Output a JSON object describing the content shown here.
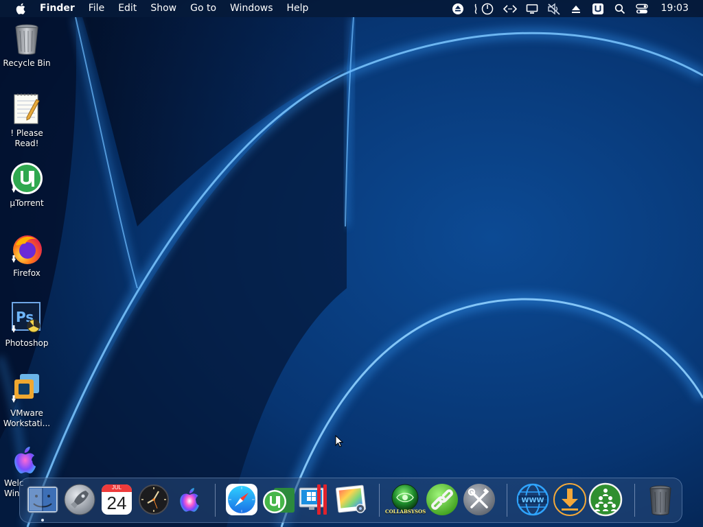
{
  "menubar": {
    "apple_icon": "apple-logo-icon",
    "items": [
      "Finder",
      "File",
      "Edit",
      "Show",
      "Go to",
      "Windows",
      "Help"
    ],
    "status_icons": [
      "eject-icon",
      "power-timer-icon",
      "code-icon",
      "display-icon",
      "mute-icon",
      "upload-arrow-icon",
      "u-badge-icon",
      "search-icon",
      "control-center-icon"
    ],
    "clock": "19:03"
  },
  "desktop": {
    "icons": [
      {
        "label": "Recycle Bin",
        "icon": "recycle-bin-icon"
      },
      {
        "label": "! Please Read!",
        "icon": "text-note-icon"
      },
      {
        "label": "µTorrent",
        "icon": "utorrent-icon"
      },
      {
        "label": "Firefox",
        "icon": "firefox-icon"
      },
      {
        "label": "Photoshop",
        "icon": "photoshop-icon"
      },
      {
        "label": "VMware\nWorkstati...",
        "icon": "vmware-icon"
      },
      {
        "label": "Welc\nWin",
        "icon": "apple-welcome-icon"
      }
    ]
  },
  "dock": {
    "items": [
      {
        "icon": "finder-icon"
      },
      {
        "icon": "launchpad-rocket-icon"
      },
      {
        "icon": "calendar-icon",
        "month": "JUL",
        "day": "24"
      },
      {
        "icon": "clock-icon"
      },
      {
        "icon": "siri-icon"
      },
      {
        "icon": "safari-icon"
      },
      {
        "icon": "utorrent-icon"
      },
      {
        "icon": "parallels-windows-icon"
      },
      {
        "icon": "preview-photos-icon"
      },
      {
        "icon": "collabsysos-icon",
        "label": "COLLABSYSOS"
      },
      {
        "icon": "link-icon"
      },
      {
        "icon": "system-tools-icon"
      },
      {
        "icon": "www-globe-icon"
      },
      {
        "icon": "download-icon"
      },
      {
        "icon": "network-users-icon"
      },
      {
        "icon": "trash-icon"
      }
    ]
  },
  "colors": {
    "wallpaper_base": "#062a5c",
    "glow": "#3aa0ff",
    "menubar_text": "#ffffff"
  }
}
